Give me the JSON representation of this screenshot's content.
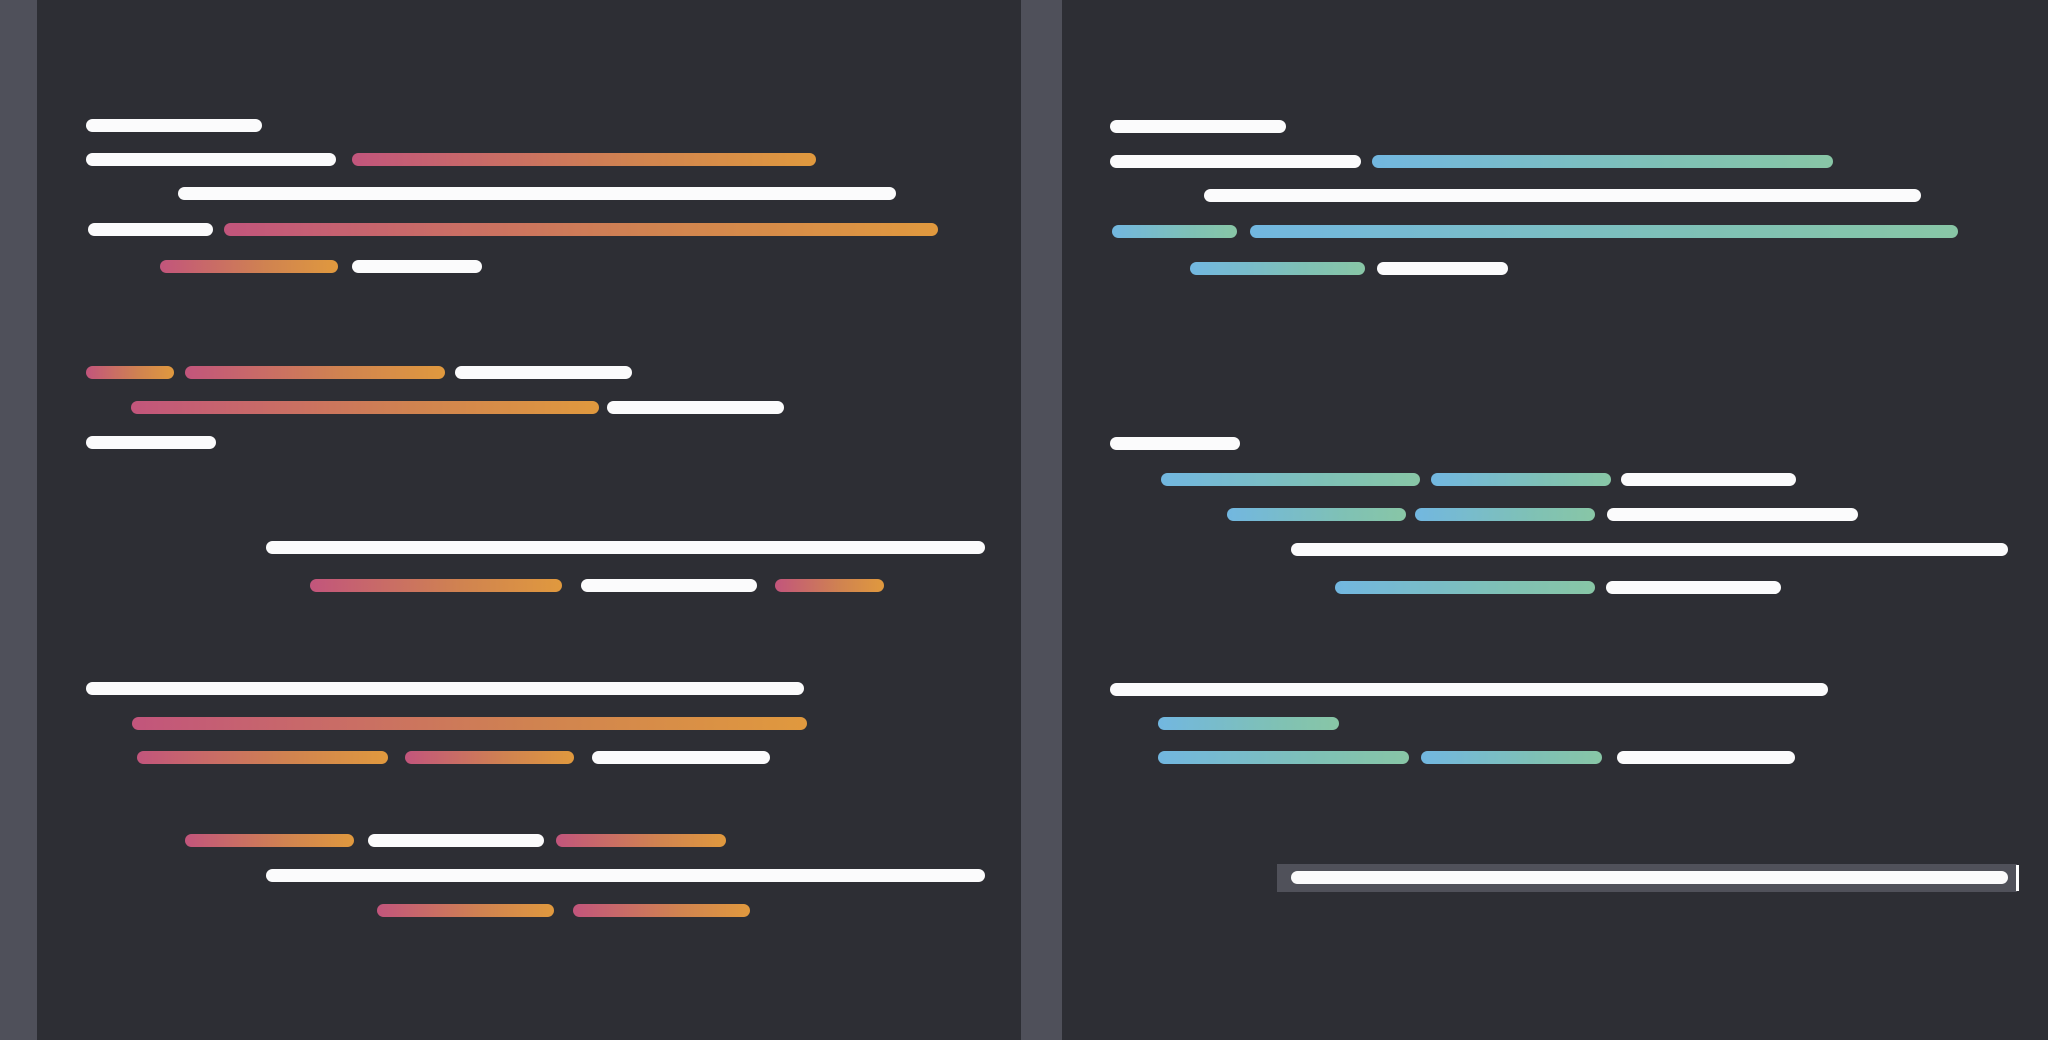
{
  "colors": {
    "background": "#2d2e34",
    "gutter": "#4f505a",
    "text_line": "#fbfbfc",
    "left_accent_start": "#c2557c",
    "left_accent_end": "#e0993e",
    "right_accent_start": "#72b7e0",
    "right_accent_end": "#88c6a6",
    "current_line_highlight": "#50515a"
  },
  "panes": [
    {
      "name": "left-code-pane",
      "accent": "warm"
    },
    {
      "name": "right-code-pane",
      "accent": "cool"
    }
  ],
  "cursor": {
    "visible": true
  }
}
